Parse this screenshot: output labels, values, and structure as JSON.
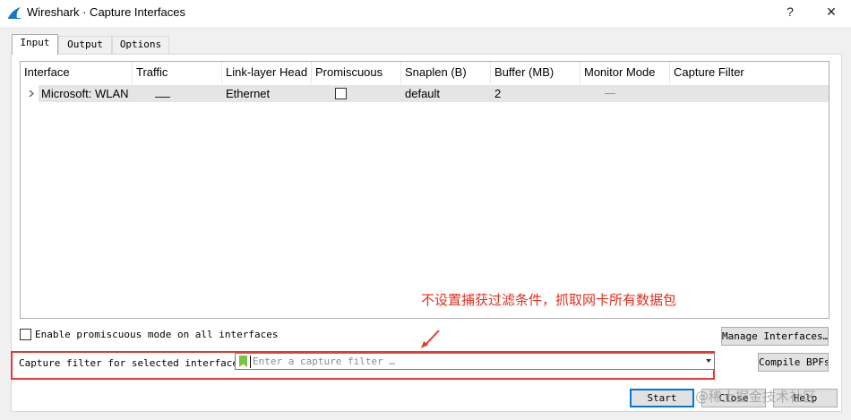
{
  "window": {
    "title": "Wireshark · Capture Interfaces",
    "help_glyph": "?",
    "close_glyph": "✕"
  },
  "tabs": [
    {
      "label": "Input",
      "active": true
    },
    {
      "label": "Output",
      "active": false
    },
    {
      "label": "Options",
      "active": false
    }
  ],
  "interfaces_table": {
    "columns": [
      "Interface",
      "Traffic",
      "Link-layer Head",
      "Promiscuous",
      "Snaplen (B)",
      "Buffer (MB)",
      "Monitor Mode",
      "Capture Filter"
    ],
    "rows": [
      {
        "interface": "Microsoft: WLAN",
        "link_layer": "Ethernet",
        "promiscuous": false,
        "snaplen": "default",
        "buffer": "2",
        "monitor_mode": "—",
        "capture_filter": ""
      }
    ]
  },
  "annotation": {
    "text": "不设置捕获过滤条件，抓取网卡所有数据包",
    "color": "#e0301e"
  },
  "promiscuous_all": {
    "label": "Enable promiscuous mode on all interfaces",
    "checked": false
  },
  "buttons": {
    "manage_interfaces": "Manage Interfaces…",
    "compile_bpfs": "Compile BPFs",
    "start": "Start",
    "close": "Close",
    "help": "Help"
  },
  "capture_filter": {
    "label": "Capture filter for selected interfaces:",
    "placeholder": "Enter a capture filter …",
    "value": ""
  },
  "watermark": "@稀土掘金技术社区",
  "colors": {
    "accent_blue": "#0078d7",
    "highlight_red": "#e53935",
    "bookmark_green": "#7cc242"
  }
}
